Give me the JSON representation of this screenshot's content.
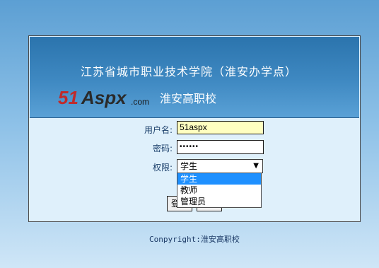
{
  "header": {
    "title": "江苏省城市职业技术学院（淮安办学点）",
    "school": "淮安高职校",
    "logo_text_51": "51",
    "logo_text_aspx": "Aspx",
    "logo_text_com": ".com"
  },
  "form": {
    "username_label": "用户名:",
    "username_value": "51aspx",
    "password_label": "密码:",
    "password_value": "••••••",
    "role_label": "权限:",
    "role_selected": "学生",
    "role_options": [
      "学生",
      "教师",
      "管理员"
    ],
    "login_button": "登录",
    "cancel_button": "取消"
  },
  "footer": {
    "text": "Conpyright:淮安高职校"
  },
  "colors": {
    "accent": "#1e90ff",
    "highlight": "#ffffc0",
    "banner": "#2b74ad"
  }
}
